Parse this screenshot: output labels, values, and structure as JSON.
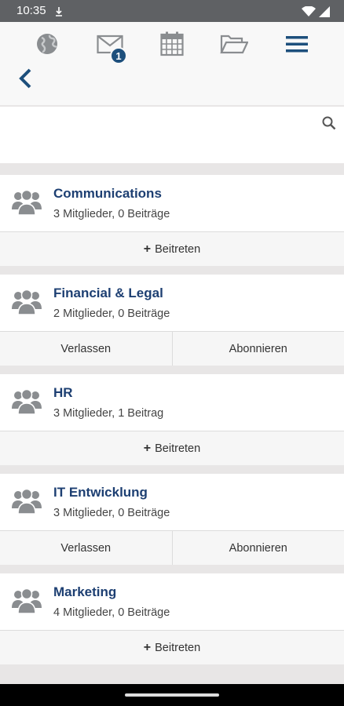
{
  "status_bar": {
    "time": "10:35"
  },
  "nav": {
    "mail_badge": "1"
  },
  "search": {
    "placeholder": "",
    "value": ""
  },
  "groups": [
    {
      "name": "Communications",
      "meta": "3 Mitglieder, 0 Beiträge",
      "join": "Beitreten"
    },
    {
      "name": "Financial & Legal",
      "meta": "2 Mitglieder, 0 Beiträge",
      "leave": "Verlassen",
      "subscribe": "Abonnieren"
    },
    {
      "name": "HR",
      "meta": "3 Mitglieder, 1 Beitrag",
      "join": "Beitreten"
    },
    {
      "name": "IT Entwicklung",
      "meta": "3 Mitglieder, 0 Beiträge",
      "leave": "Verlassen",
      "subscribe": "Abonnieren"
    },
    {
      "name": "Marketing",
      "meta": "4 Mitglieder, 0 Beiträge",
      "join": "Beitreten"
    }
  ]
}
